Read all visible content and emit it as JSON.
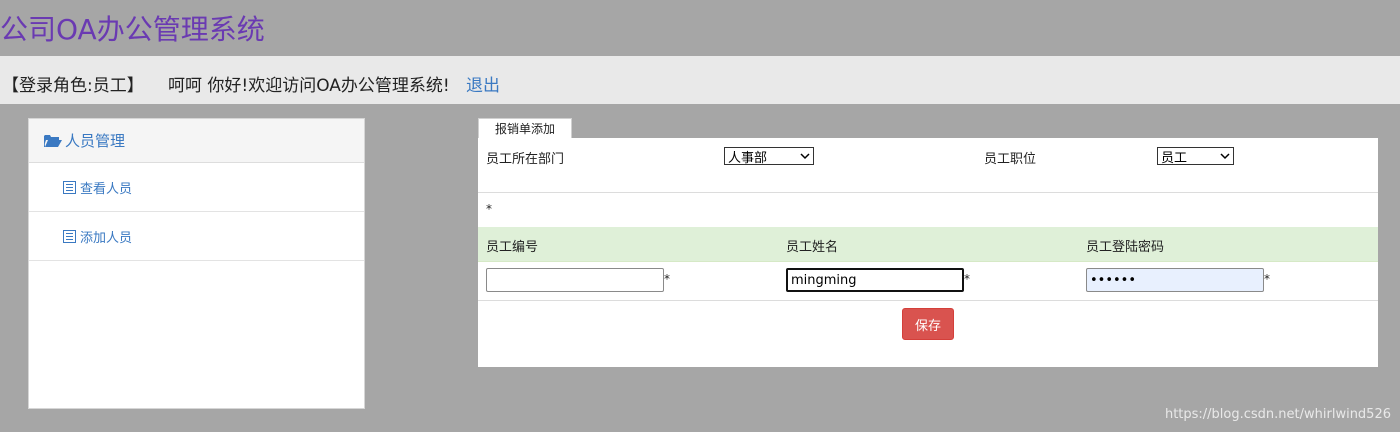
{
  "app": {
    "title": "公司OA办公管理系统"
  },
  "topbar": {
    "role": "【登录角色:员工】",
    "welcome": "呵呵 你好!欢迎访问OA办公管理系统!",
    "logout": "退出"
  },
  "sidebar": {
    "heading": "人员管理",
    "items": [
      {
        "label": "查看人员",
        "icon": "list-icon"
      },
      {
        "label": "添加人员",
        "icon": "list-icon"
      }
    ]
  },
  "form": {
    "tab_label": "报销单添加",
    "department_label": "员工所在部门",
    "department_value": "人事部",
    "position_label": "员工职位",
    "position_value": "员工",
    "required_note": "*",
    "columns": [
      "员工编号",
      "员工姓名",
      "员工登陆密码"
    ],
    "employee_id_value": "",
    "employee_name_value": "mingming",
    "password_value": "••••••",
    "required_mark": "*",
    "save_label": "保存"
  },
  "watermark": "https://blog.csdn.net/whirlwind526",
  "colors": {
    "title": "#6a3ab2",
    "link": "#3a79c2",
    "header_row": "#dff0d8",
    "save_button": "#d9534f",
    "background": "#a6a6a6"
  }
}
